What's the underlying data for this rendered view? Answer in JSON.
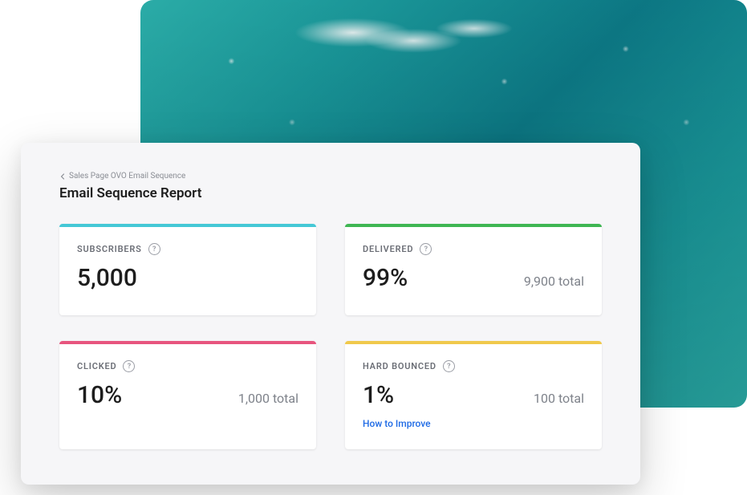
{
  "breadcrumb": {
    "label": "Sales Page OVO Email Sequence"
  },
  "title": "Email Sequence Report",
  "colors": {
    "accent_subscribers": "#45c8d6",
    "accent_delivered": "#3fb653",
    "accent_clicked": "#e7557e",
    "accent_hardbounced": "#f0c94c",
    "link": "#1e6ae5"
  },
  "cards": {
    "subscribers": {
      "label": "SUBSCRIBERS",
      "value": "5,000",
      "total": ""
    },
    "delivered": {
      "label": "DELIVERED",
      "value": "99%",
      "total": "9,900 total"
    },
    "clicked": {
      "label": "CLICKED",
      "value": "10%",
      "total": "1,000 total"
    },
    "hardbounced": {
      "label": "HARD BOUNCED",
      "value": "1%",
      "total": "100 total",
      "link": "How to Improve"
    }
  }
}
